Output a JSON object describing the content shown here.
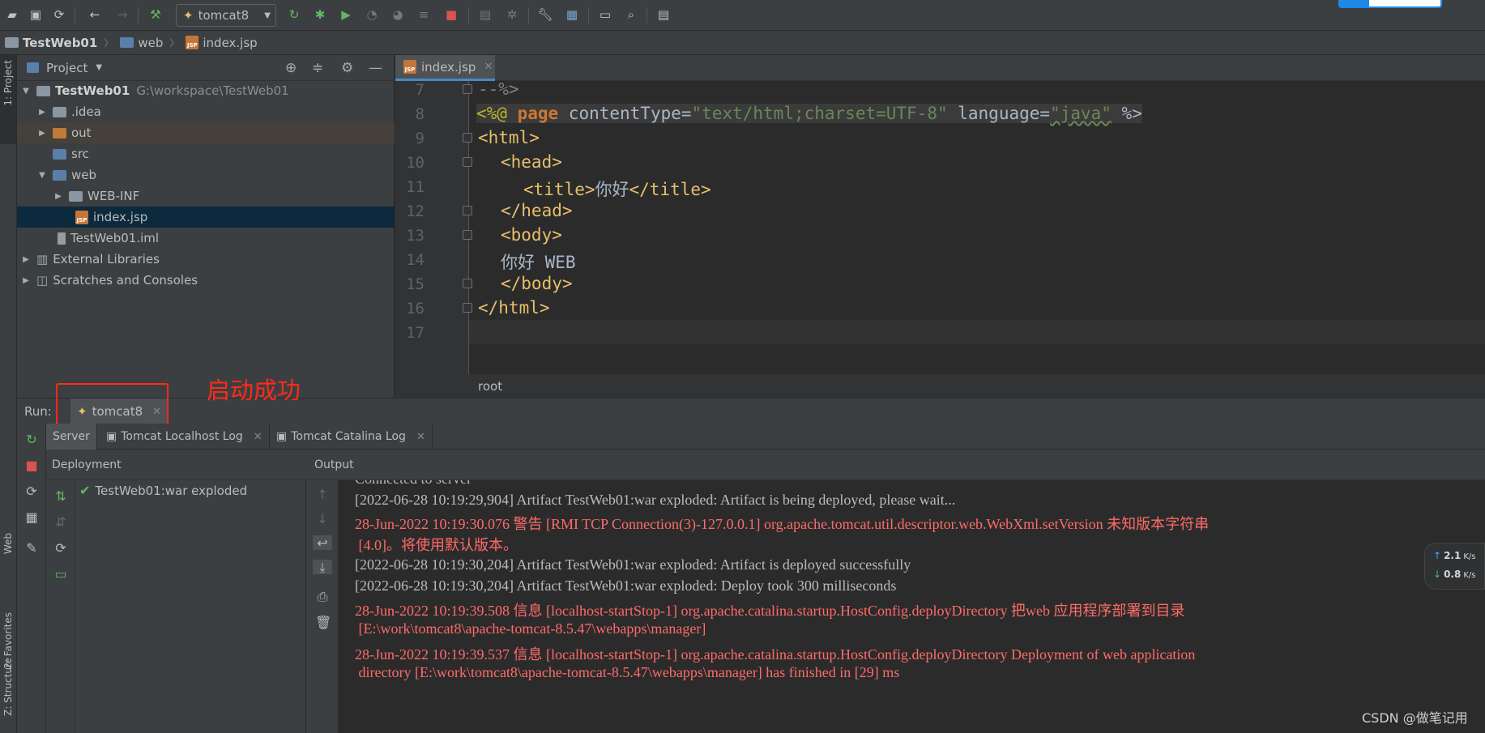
{
  "toolbar": {
    "run_config": "tomcat8",
    "icons": [
      "open-icon",
      "save-icon",
      "sync-icon",
      "back-icon",
      "forward-icon",
      "build-icon",
      "rerun-icon",
      "debug-icon",
      "run-coverage-icon",
      "profile-icon",
      "attach-icon",
      "step-icon",
      "stop-icon",
      "sdk-icon",
      "vcs-icon",
      "settings-icon",
      "project-structure-icon",
      "terminal-icon",
      "search-icon",
      "structure-icon"
    ]
  },
  "breadcrumb": {
    "project": "TestWeb01",
    "folder": "web",
    "file": "index.jsp"
  },
  "left_stripe": {
    "project_label": "1: Project",
    "web_label": "Web",
    "favorites_label": "2: Favorites",
    "structure_label": "Z: Structure"
  },
  "project_panel": {
    "title": "Project",
    "tree": [
      {
        "label": "TestWeb01",
        "path": "G:\\workspace\\TestWeb01"
      },
      {
        "label": ".idea"
      },
      {
        "label": "out"
      },
      {
        "label": "src"
      },
      {
        "label": "web"
      },
      {
        "label": "WEB-INF"
      },
      {
        "label": "index.jsp"
      },
      {
        "label": "TestWeb01.iml"
      },
      {
        "label": "External Libraries"
      },
      {
        "label": "Scratches and Consoles"
      }
    ]
  },
  "editor": {
    "tab_label": "index.jsp",
    "line_numbers": [
      "7",
      "8",
      "9",
      "10",
      "11",
      "12",
      "13",
      "14",
      "15",
      "16",
      "17"
    ],
    "lines": {
      "l7": "--%>",
      "l8_open": "<%@ ",
      "l8_page": "page",
      "l8_ct": " contentType=",
      "l8_ct_val": "\"text/html;charset=UTF-8\"",
      "l8_lang": " language=",
      "l8_lang_val": "\"java\"",
      "l8_close": " %>",
      "l9": "<html>",
      "l10": "<head>",
      "l11_open": "<title>",
      "l11_text": "你好",
      "l11_close": "</title>",
      "l12": "</head>",
      "l13": "<body>",
      "l14": "你好 WEB",
      "l15": "</body>",
      "l16": "</html>"
    },
    "status_path": "root"
  },
  "run_panel": {
    "label": "Run:",
    "tab": "tomcat8",
    "annotation": "启动成功",
    "subtabs": [
      "Server",
      "Tomcat Localhost Log",
      "Tomcat Catalina Log"
    ],
    "deployment_header": "Deployment",
    "output_header": "Output",
    "deployment_item": "TestWeb01:war exploded",
    "console": [
      {
        "text": "Connected to server",
        "color": "normal"
      },
      {
        "text": "[2022-06-28 10:19:29,904] Artifact TestWeb01:war exploded: Artifact is being deployed, please wait...",
        "color": "normal"
      },
      {
        "text": "28-Jun-2022 10:19:30.076 警告 [RMI TCP Connection(3)-127.0.0.1] org.apache.tomcat.util.descriptor.web.WebXml.setVersion 未知版本字符串",
        "color": "red"
      },
      {
        "text": " [4.0]。将使用默认版本。",
        "color": "red"
      },
      {
        "text": "[2022-06-28 10:19:30,204] Artifact TestWeb01:war exploded: Artifact is deployed successfully",
        "color": "normal"
      },
      {
        "text": "[2022-06-28 10:19:30,204] Artifact TestWeb01:war exploded: Deploy took 300 milliseconds",
        "color": "normal"
      },
      {
        "text": "28-Jun-2022 10:19:39.508 信息 [localhost-startStop-1] org.apache.catalina.startup.HostConfig.deployDirectory 把web 应用程序部署到目录",
        "color": "red"
      },
      {
        "text": " [E:\\work\\tomcat8\\apache-tomcat-8.5.47\\webapps\\manager]",
        "color": "red"
      },
      {
        "text": "28-Jun-2022 10:19:39.537 信息 [localhost-startStop-1] org.apache.catalina.startup.HostConfig.deployDirectory Deployment of web application",
        "color": "red"
      },
      {
        "text": " directory [E:\\work\\tomcat8\\apache-tomcat-8.5.47\\webapps\\manager] has finished in [29] ms",
        "color": "red"
      }
    ]
  },
  "net_widget": {
    "up_value": "2.1",
    "up_unit": "K/s",
    "down_value": "0.8",
    "down_unit": "K/s"
  },
  "watermark": "CSDN @做笔记用",
  "colors": {
    "accent": "#4a88c7",
    "error_text": "#ff6b68",
    "annotation": "#ff2a1a"
  }
}
